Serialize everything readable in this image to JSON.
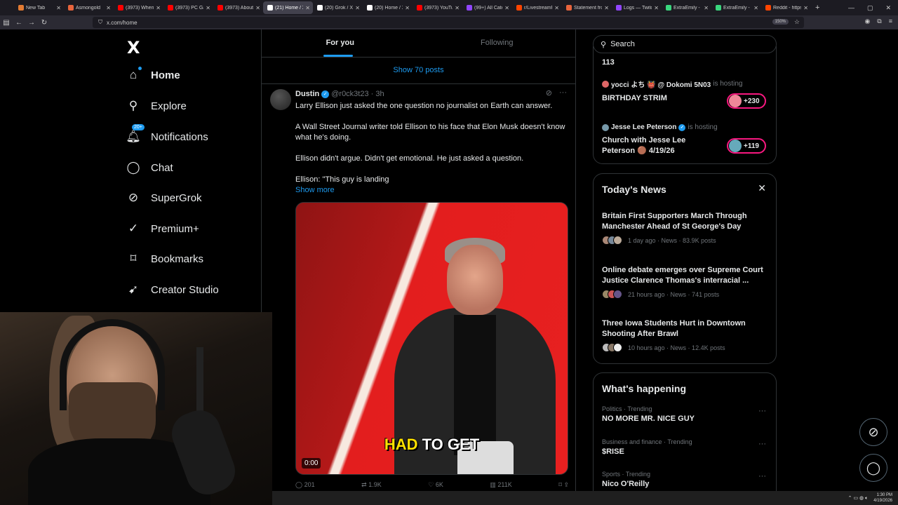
{
  "browser": {
    "tabs": [
      {
        "label": "New Tab",
        "color": "#e37b32"
      },
      {
        "label": "Asmongold",
        "color": "#e8643c"
      },
      {
        "label": "(3973) When a",
        "color": "#ff0000"
      },
      {
        "label": "(3973) PC Gam",
        "color": "#ff0000"
      },
      {
        "label": "(3973) About T",
        "color": "#ff0000"
      },
      {
        "label": "(21) Home / X",
        "color": "#ffffff",
        "active": true
      },
      {
        "label": "(20) Grok / X",
        "color": "#ffffff"
      },
      {
        "label": "(20) Home / X",
        "color": "#ffffff"
      },
      {
        "label": "(3973) YouTube",
        "color": "#ff0000"
      },
      {
        "label": "(99+) All Categ",
        "color": "#9146ff"
      },
      {
        "label": "r/LivestreamFail",
        "color": "#ff4500"
      },
      {
        "label": "Statement from",
        "color": "#e8643c"
      },
      {
        "label": "Logs — Twitch",
        "color": "#9146ff"
      },
      {
        "label": "ExtraEmily - Str",
        "color": "#3ad67e"
      },
      {
        "label": "ExtraEmily - Str",
        "color": "#3ad67e"
      },
      {
        "label": "Reddit - https:/",
        "color": "#ff4500"
      }
    ],
    "url": "x.com/home",
    "zoom": "150%"
  },
  "sidebar": {
    "logo": "X",
    "items": [
      {
        "label": "Home",
        "icon": "home-icon"
      },
      {
        "label": "Explore",
        "icon": "search-icon"
      },
      {
        "label": "Notifications",
        "icon": "bell-icon",
        "badge": "20+"
      },
      {
        "label": "Chat",
        "icon": "chat-icon"
      },
      {
        "label": "SuperGrok",
        "icon": "grok-icon"
      },
      {
        "label": "Premium+",
        "icon": "verified-icon"
      },
      {
        "label": "Bookmarks",
        "icon": "bookmark-icon"
      },
      {
        "label": "Creator Studio",
        "icon": "rocket-icon"
      }
    ]
  },
  "feed": {
    "tabs": [
      "For you",
      "Following"
    ],
    "show_posts": "Show 70 posts",
    "post": {
      "name": "Dustin",
      "handle": "@r0ck3t23 · 3h",
      "paragraphs": [
        "Larry Ellison just asked the one question no journalist on Earth can answer.",
        "A Wall Street Journal writer told Ellison to his face that Elon Musk doesn't know what he's doing.",
        "Ellison didn't argue. Didn't get emotional. He just asked a question.",
        "Ellison: \"This guy is landing"
      ],
      "show_more": "Show more",
      "video_caption_highlight": "HAD",
      "video_caption_rest": " TO GET",
      "video_time": "0:00",
      "actions": {
        "replies": "201",
        "reposts": "1.9K",
        "likes": "6K",
        "views": "211K"
      }
    }
  },
  "right": {
    "search_placeholder": "Search",
    "live": [
      {
        "host": "",
        "is": "",
        "title": "113"
      },
      {
        "host": "yocci よち 👹 @ Dokomi 5N03",
        "is": "is hosting",
        "title": "BIRTHDAY STRIM",
        "count": "+230"
      },
      {
        "host": "Jesse Lee Peterson",
        "is": "is hosting",
        "title": "Church with Jesse Lee Peterson 🟤 4/19/26",
        "count": "+119"
      }
    ],
    "news_title": "Today's News",
    "news": [
      {
        "title": "Britain First Supporters March Through Manchester Ahead of St George's Day",
        "meta": "1 day ago · News · 83.9K posts"
      },
      {
        "title": "Online debate emerges over Supreme Court Justice Clarence Thomas's interracial ...",
        "meta": "21 hours ago · News · 741 posts"
      },
      {
        "title": "Three Iowa Students Hurt in Downtown Shooting After Brawl",
        "meta": "10 hours ago · News · 12.4K posts"
      }
    ],
    "happening_title": "What's happening",
    "trends": [
      {
        "category": "Politics · Trending",
        "title": "NO MORE MR. NICE GUY"
      },
      {
        "category": "Business and finance · Trending",
        "title": "$RISE"
      },
      {
        "category": "Sports · Trending",
        "title": "Nico O'Reilly"
      }
    ]
  },
  "taskbar": {
    "time": "1:30 PM",
    "date": "4/19/2026"
  },
  "colors": {
    "accent": "#1d9bf0",
    "live": "#f91880"
  }
}
